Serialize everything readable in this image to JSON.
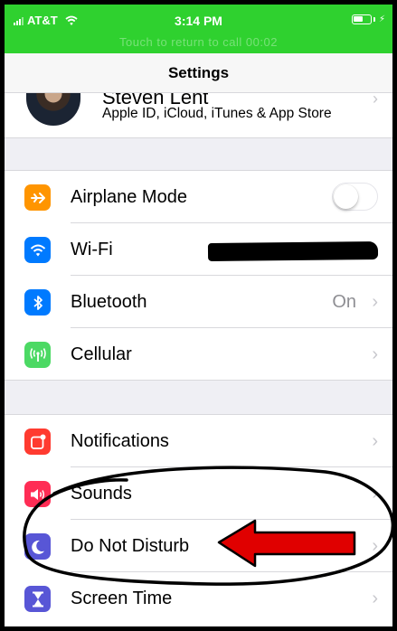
{
  "status_bar": {
    "carrier": "AT&T",
    "time": "3:14 PM",
    "call_banner": "Touch to return to call 00:02",
    "signal_icon": "signal-bars-icon",
    "wifi_icon": "wifi-icon",
    "battery_icon": "battery-icon",
    "charge_icon": "charging-bolt-icon",
    "background_color": "#2fd12f"
  },
  "nav": {
    "title": "Settings"
  },
  "profile": {
    "name": "Steven Lent",
    "subtitle": "Apple ID, iCloud, iTunes & App Store",
    "chevron": "›"
  },
  "settings_group_1": [
    {
      "label": "Airplane Mode",
      "icon": "airplane-icon",
      "icon_color": "#ff9500",
      "control": "toggle",
      "toggle_on": false
    },
    {
      "label": "Wi-Fi",
      "icon": "wifi-icon",
      "icon_color": "#007aff",
      "control": "redacted"
    },
    {
      "label": "Bluetooth",
      "icon": "bluetooth-icon",
      "icon_color": "#007aff",
      "detail": "On",
      "chevron": "›"
    },
    {
      "label": "Cellular",
      "icon": "cellular-icon",
      "icon_color": "#4cd964",
      "chevron": "›"
    }
  ],
  "settings_group_2": [
    {
      "label": "Notifications",
      "icon": "notifications-icon",
      "icon_color": "#ff3b30",
      "chevron": "›"
    },
    {
      "label": "Sounds",
      "icon": "speaker-icon",
      "icon_color": "#ff2d55",
      "chevron": "›"
    },
    {
      "label": "Do Not Disturb",
      "icon": "moon-icon",
      "icon_color": "#5856d6",
      "chevron": "›"
    },
    {
      "label": "Screen Time",
      "icon": "hourglass-icon",
      "icon_color": "#5856d6",
      "chevron": "›"
    }
  ],
  "annotations": {
    "circle_color": "#000000",
    "arrow_color": "#e00000",
    "arrow_icon": "red-arrow-icon",
    "circle_icon": "hand-drawn-circle-icon"
  }
}
